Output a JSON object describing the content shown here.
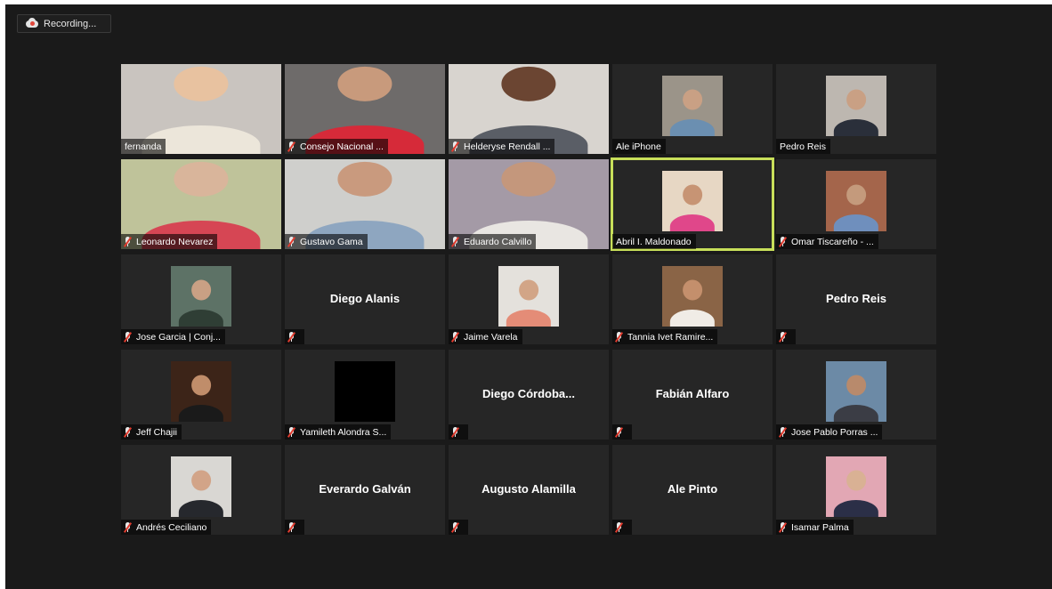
{
  "recording": {
    "label": "Recording..."
  },
  "participants": [
    {
      "name": "fernanda",
      "muted": false,
      "video": "full",
      "bg": "#c9c4bf",
      "skin": "#e8c2a0",
      "shirt": "#ece6da"
    },
    {
      "name": "Consejo Nacional ...",
      "muted": true,
      "video": "full",
      "bg": "#6e6b6a",
      "skin": "#c89a7c",
      "shirt": "#d62a39"
    },
    {
      "name": "Helderyse Rendall ...",
      "muted": true,
      "video": "full",
      "bg": "#d8d4cf",
      "skin": "#6b4532",
      "shirt": "#5a5e66"
    },
    {
      "name": "Ale iPhone",
      "muted": false,
      "video": "thumb",
      "bg": "#9b9489",
      "skin": "#c9a084",
      "shirt": "#6b8fb1"
    },
    {
      "name": "Pedro Reis",
      "muted": false,
      "video": "thumb",
      "bg": "#bdb7b0",
      "skin": "#c9a084",
      "shirt": "#2a2f3a"
    },
    {
      "name": "Leonardo Nevarez",
      "muted": true,
      "video": "full",
      "bg": "#bfc39a",
      "skin": "#d9b59b",
      "shirt": "#d64654"
    },
    {
      "name": "Gustavo Gama",
      "muted": true,
      "video": "full",
      "bg": "#cfcfcc",
      "skin": "#c99a7e",
      "shirt": "#8ea6c0"
    },
    {
      "name": "Eduardo Calvillo",
      "muted": true,
      "video": "full",
      "bg": "#a49aa6",
      "skin": "#c4977c",
      "shirt": "#e9e6e2"
    },
    {
      "name": "Abril I. Maldonado",
      "muted": false,
      "video": "thumb",
      "active": true,
      "bg": "#e7d7c4",
      "skin": "#c79474",
      "shirt": "#e0478a"
    },
    {
      "name": "Omar Tiscareño - ...",
      "muted": true,
      "video": "thumb",
      "bg": "#a4654b",
      "skin": "#c49a7c",
      "shirt": "#6f8fbd"
    },
    {
      "name": "Jose Garcia | Conj...",
      "muted": true,
      "video": "thumb",
      "bg": "#5d7266",
      "skin": "#c9a084",
      "shirt": "#2f3e35"
    },
    {
      "name": "",
      "muted": true,
      "video": "none",
      "bigname": "Diego Alanis"
    },
    {
      "name": "Jaime Varela",
      "muted": true,
      "video": "thumb",
      "bg": "#e4e1dc",
      "skin": "#d2a587",
      "shirt": "#e48c77"
    },
    {
      "name": "Tannia Ivet Ramire...",
      "muted": true,
      "video": "thumb",
      "bg": "#8a6446",
      "skin": "#c48f6c",
      "shirt": "#f0ece6"
    },
    {
      "name": "",
      "muted": true,
      "video": "none",
      "bigname": "Pedro Reis"
    },
    {
      "name": "Jeff Chajii",
      "muted": true,
      "video": "thumb",
      "bg": "#3c2418",
      "skin": "#c08d6a",
      "shirt": "#1a1a1a"
    },
    {
      "name": "Yamileth Alondra S...",
      "muted": true,
      "video": "black"
    },
    {
      "name": "",
      "muted": true,
      "video": "none",
      "bigname": "Diego  Córdoba..."
    },
    {
      "name": "",
      "muted": true,
      "video": "none",
      "bigname": "Fabián Alfaro"
    },
    {
      "name": "Jose Pablo Porras ...",
      "muted": true,
      "video": "thumb",
      "bg": "#6c8aa6",
      "skin": "#b88a6c",
      "shirt": "#3b3d45"
    },
    {
      "name": "Andrés Ceciliano",
      "muted": true,
      "video": "thumb",
      "bg": "#d9d7d3",
      "skin": "#d2a488",
      "shirt": "#26282d"
    },
    {
      "name": "",
      "muted": true,
      "video": "none",
      "bigname": "Everardo Galván"
    },
    {
      "name": "",
      "muted": true,
      "video": "none",
      "bigname": "Augusto Alamilla"
    },
    {
      "name": "",
      "muted": true,
      "video": "none",
      "bigname": "Ale Pinto"
    },
    {
      "name": "Isamar Palma",
      "muted": true,
      "video": "thumb",
      "bg": "#e2a7b4",
      "skin": "#d9b194",
      "shirt": "#2b2f47"
    }
  ],
  "colors": {
    "active_border": "#c8df5a",
    "mute_slash": "#e23b2e",
    "tile_bg": "#262626",
    "screen_bg": "#1a1a1a"
  }
}
